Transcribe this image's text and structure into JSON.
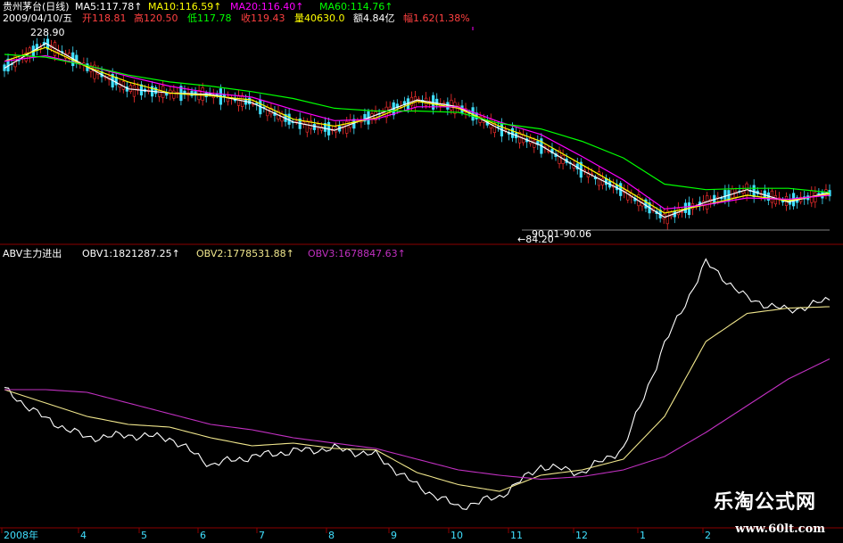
{
  "header": {
    "stock": "贵州茅台(日线)",
    "date": "2009/04/10/五",
    "ma5": "MA5:117.78↑",
    "ma10": "MA10:116.59↑",
    "ma20": "MA20:116.40↑",
    "ma60": "MA60:114.76↑",
    "open": "开118.81",
    "high": "高120.50",
    "low": "低117.78",
    "close": "收119.43",
    "volume": "量40630.0",
    "amount": "额4.84亿",
    "change": "幅1.62(1.38%"
  },
  "indicator": {
    "name": "ABV主力进出",
    "obv1": "OBV1:1821287.25↑",
    "obv2": "OBV2:1778531.88↑",
    "obv3": "OBV3:1678847.63↑"
  },
  "annotations": {
    "high_label": "228.90",
    "low_label": "←84.20",
    "range_label": "90.01-90.06"
  },
  "xaxis": {
    "labels": [
      "2008年",
      "4",
      "5",
      "6",
      "7",
      "8",
      "9",
      "10",
      "11",
      "12",
      "1",
      "2"
    ]
  },
  "watermark": {
    "cn": "乐淘公式网",
    "url": "www.60lt.com"
  },
  "colors": {
    "ma5": "#ffffff",
    "ma10": "#ffff00",
    "ma20": "#ff00ff",
    "ma60": "#00ff00",
    "up": "#ff3030",
    "down": "#40e0ff",
    "obv1": "#ffffff",
    "obv2": "#f0e68c",
    "obv3": "#c030c0",
    "grid": "#8b0000"
  },
  "chart_data": [
    {
      "type": "line",
      "panel": "price",
      "ylim": [
        80,
        235
      ],
      "x": [
        0,
        5,
        10,
        15,
        20,
        25,
        30,
        35,
        40,
        45,
        50,
        55,
        60,
        65,
        70,
        75,
        80,
        85,
        90,
        95,
        100
      ],
      "series": [
        {
          "name": "MA5",
          "values": [
            205,
            223,
            206,
            190,
            187,
            186,
            180,
            166,
            160,
            171,
            182,
            177,
            161,
            149,
            131,
            116,
            97,
            108,
            117,
            108,
            115
          ]
        },
        {
          "name": "MA10",
          "values": [
            210,
            220,
            206,
            195,
            187,
            185,
            182,
            168,
            163,
            169,
            181,
            176,
            163,
            152,
            135,
            118,
            100,
            106,
            113,
            109,
            114
          ]
        },
        {
          "name": "MA20",
          "values": [
            210,
            214,
            207,
            199,
            192,
            187,
            184,
            175,
            167,
            168,
            177,
            177,
            166,
            157,
            141,
            124,
            103,
            106,
            111,
            110,
            113
          ]
        },
        {
          "name": "MA60",
          "values": [
            215,
            213,
            207,
            200,
            195,
            192,
            188,
            183,
            176,
            174,
            174,
            173,
            165,
            161,
            152,
            140,
            121,
            117,
            118,
            118,
            115
          ]
        }
      ]
    },
    {
      "type": "line",
      "panel": "ABV",
      "ylim": [
        -100,
        100
      ],
      "x": [
        0,
        5,
        10,
        15,
        20,
        25,
        30,
        35,
        40,
        45,
        50,
        55,
        60,
        65,
        70,
        75,
        80,
        85,
        90,
        95,
        100
      ],
      "series": [
        {
          "name": "OBV1",
          "values": [
            2,
            -20,
            -34,
            -32,
            -34,
            -54,
            -48,
            -44,
            -42,
            -47,
            -70,
            -86,
            -78,
            -55,
            -60,
            -42,
            36,
            97,
            70,
            61,
            69
          ]
        },
        {
          "name": "OBV2",
          "values": [
            2,
            -8,
            -18,
            -24,
            -26,
            -34,
            -40,
            -38,
            -42,
            -43,
            -60,
            -69,
            -74,
            -62,
            -58,
            -50,
            -18,
            38,
            59,
            63,
            64
          ]
        },
        {
          "name": "OBV3",
          "values": [
            2,
            2,
            0,
            -8,
            -16,
            -24,
            -28,
            -34,
            -38,
            -42,
            -50,
            -58,
            -62,
            -65,
            -63,
            -58,
            -48,
            -30,
            -10,
            10,
            25
          ]
        }
      ]
    }
  ]
}
